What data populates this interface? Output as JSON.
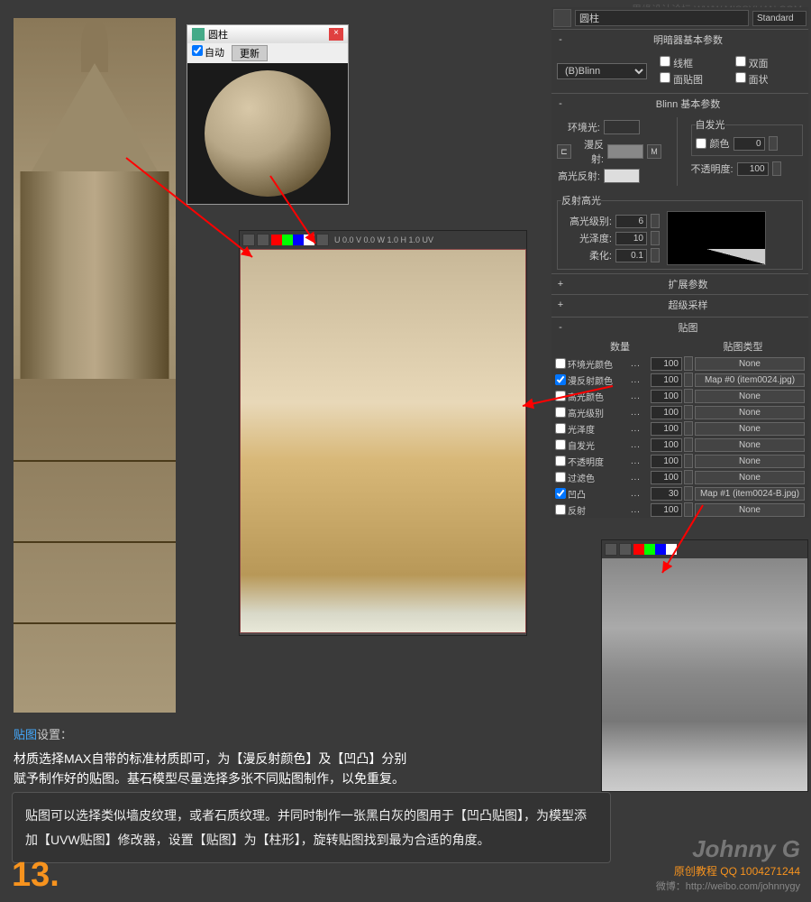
{
  "watermark": "思缘设计论坛   WWW.MISSYUAN.COM",
  "preview": {
    "title": "圆柱",
    "auto": "自动",
    "update": "更新"
  },
  "uv": {
    "toolbar": "U 0.0  V 0.0  W 1.0  H 1.0  UV"
  },
  "material": {
    "name": "圆柱",
    "type": "Standard",
    "shader_section": "明暗器基本参数",
    "shader": "(B)Blinn",
    "wireframe": "线框",
    "twosided": "双面",
    "facemap": "面贴图",
    "faceted": "面状",
    "blinn_section": "Blinn 基本参数",
    "ambient": "环境光:",
    "diffuse": "漫反射:",
    "specular": "高光反射:",
    "selfillum_group": "自发光",
    "selfillum": "颜色",
    "selfillum_val": "0",
    "opacity": "不透明度:",
    "opacity_val": "100",
    "spec_group": "反射高光",
    "spec_level": "高光级别:",
    "spec_level_val": "6",
    "gloss": "光泽度:",
    "gloss_val": "10",
    "soften": "柔化:",
    "soften_val": "0.1",
    "extended": "扩展参数",
    "supersample": "超级采样",
    "maps": "贴图",
    "maps_amount": "数量",
    "maps_type": "贴图类型",
    "map_rows": [
      {
        "label": "环境光颜色",
        "amt": "100",
        "btn": "None",
        "checked": false
      },
      {
        "label": "漫反射颜色",
        "amt": "100",
        "btn": "Map #0 (item0024.jpg)",
        "checked": true
      },
      {
        "label": "高光颜色",
        "amt": "100",
        "btn": "None",
        "checked": false
      },
      {
        "label": "高光级别",
        "amt": "100",
        "btn": "None",
        "checked": false
      },
      {
        "label": "光泽度",
        "amt": "100",
        "btn": "None",
        "checked": false
      },
      {
        "label": "自发光",
        "amt": "100",
        "btn": "None",
        "checked": false
      },
      {
        "label": "不透明度",
        "amt": "100",
        "btn": "None",
        "checked": false
      },
      {
        "label": "过滤色",
        "amt": "100",
        "btn": "None",
        "checked": false
      },
      {
        "label": "凹凸",
        "amt": "30",
        "btn": "Map #1 (item0024-B.jpg)",
        "checked": true
      },
      {
        "label": "反射",
        "amt": "100",
        "btn": "None",
        "checked": false
      }
    ]
  },
  "text": {
    "t1_a": "贴图",
    "t1_b": "设置：",
    "t2": "材质选择MAX自带的标准材质即可，为【漫反射颜色】及【凹凸】分别\n赋予制作好的贴图。基石模型尽量选择多张不同贴图制作，以免重复。",
    "tip": "贴图可以选择类似墙皮纹理，或者石质纹理。并同时制作一张黑白灰的图用于【凹凸贴图】，为模型添加【UVW贴图】修改器，设置【贴图】为【柱形】，旋转贴图找到最为合适的角度。"
  },
  "step": "13.",
  "credit": {
    "name": "Johnny G",
    "sub": "原创教程  QQ 1004271244",
    "weibo": "微博：http://weibo.com/johnnygy"
  }
}
